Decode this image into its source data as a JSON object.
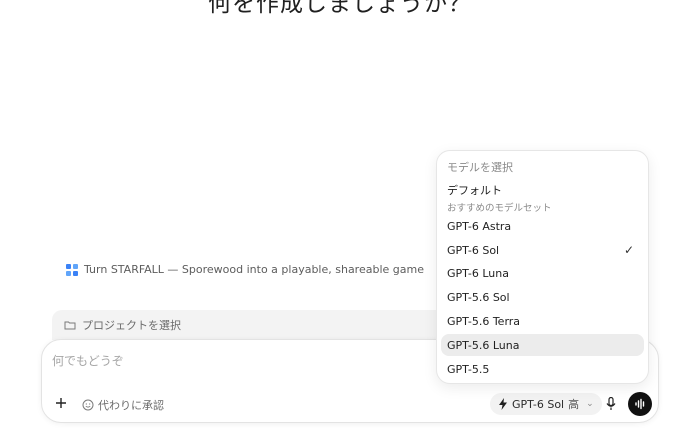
{
  "hero": {
    "title": "何を作成しましょうか？"
  },
  "suggestion": {
    "text": "Turn STARFALL — Sporewood into a playable, shareable game"
  },
  "project": {
    "label": "プロジェクトを選択"
  },
  "composer": {
    "placeholder": "何でもどうぞ",
    "approve_label": "代わりに承認",
    "model_chip": {
      "model": "GPT-6 Sol",
      "level": "高"
    }
  },
  "model_menu": {
    "header": "モデルを選択",
    "default": {
      "title": "デフォルト",
      "subtitle": "おすすめのモデルセット"
    },
    "items": [
      {
        "label": "GPT-6 Astra",
        "selected": false
      },
      {
        "label": "GPT-6 Sol",
        "selected": true
      },
      {
        "label": "GPT-6 Luna",
        "selected": false
      },
      {
        "label": "GPT-5.6 Sol",
        "selected": false
      },
      {
        "label": "GPT-5.6 Terra",
        "selected": false
      },
      {
        "label": "GPT-5.6 Luna",
        "selected": false,
        "hovered": true
      },
      {
        "label": "GPT-5.5",
        "selected": false
      }
    ],
    "check_glyph": "✓"
  }
}
